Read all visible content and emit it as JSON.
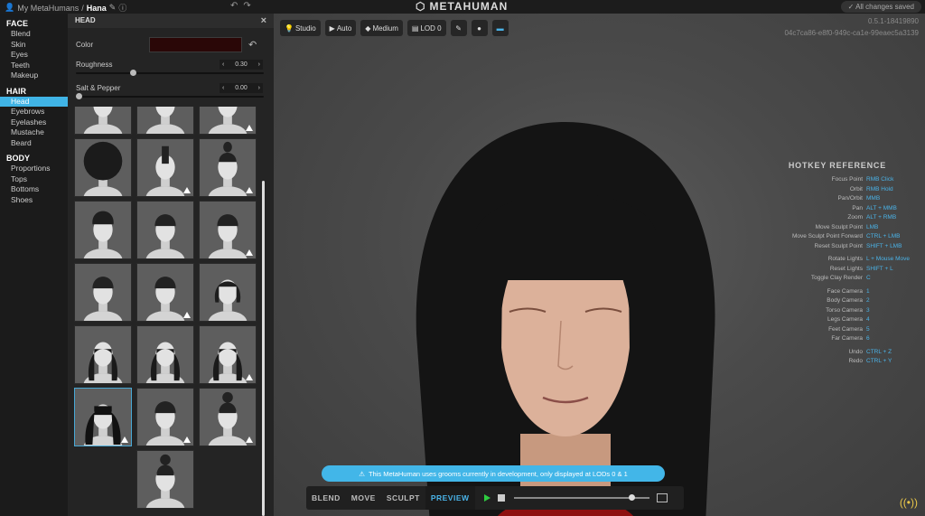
{
  "topbar": {
    "crumb_root": "My MetaHumans",
    "crumb_sep": "/",
    "crumb_current": "Hana",
    "brand": "METAHUMAN",
    "saved": "All changes saved"
  },
  "nav": {
    "sections": [
      {
        "title": "FACE",
        "items": [
          "Blend",
          "Skin",
          "Eyes",
          "Teeth",
          "Makeup"
        ]
      },
      {
        "title": "HAIR",
        "items": [
          "Head",
          "Eyebrows",
          "Eyelashes",
          "Mustache",
          "Beard"
        ]
      },
      {
        "title": "BODY",
        "items": [
          "Proportions",
          "Tops",
          "Bottoms",
          "Shoes"
        ]
      }
    ],
    "active": "Head"
  },
  "panel": {
    "title": "HEAD",
    "close": "×",
    "color_label": "Color",
    "color_value": "#2a0707",
    "roughness_label": "Roughness",
    "roughness_value": "0.30",
    "roughness_fraction": 0.3,
    "salt_label": "Salt & Pepper",
    "salt_value": "0.00",
    "salt_fraction": 0.0,
    "stepper_left": "‹",
    "stepper_right": "›"
  },
  "thumbs": [
    {
      "style": "bun",
      "warn": false
    },
    {
      "style": "bun",
      "warn": false
    },
    {
      "style": "bun",
      "warn": true
    },
    {
      "style": "afro",
      "warn": false
    },
    {
      "style": "mohawk",
      "warn": true
    },
    {
      "style": "topknot",
      "warn": true
    },
    {
      "style": "pomp",
      "warn": false
    },
    {
      "style": "short",
      "warn": false
    },
    {
      "style": "short",
      "warn": true
    },
    {
      "style": "short",
      "warn": false
    },
    {
      "style": "short",
      "warn": true
    },
    {
      "style": "bob",
      "warn": false
    },
    {
      "style": "long",
      "warn": false
    },
    {
      "style": "long",
      "warn": false
    },
    {
      "style": "long",
      "warn": true
    },
    {
      "style": "longbangs",
      "warn": true,
      "selected": true
    },
    {
      "style": "short",
      "warn": true
    },
    {
      "style": "topbun",
      "warn": true
    },
    {
      "style": "topbun",
      "warn": false
    }
  ],
  "viewport": {
    "toolbar": [
      "Studio",
      "Auto",
      "Medium",
      "LOD 0"
    ],
    "version": "0.5.1-18419890",
    "hash": "04c7ca86-e8f0-949c-ca1e-99eaec5a3139",
    "hotkey_title": "HOTKEY REFERENCE",
    "hotkeys": [
      {
        "a": "Focus Point",
        "k": "RMB Click"
      },
      {
        "a": "Orbit",
        "k": "RMB Hold"
      },
      {
        "a": "Pan/Orbit",
        "k": "MMB"
      },
      {
        "a": "Pan",
        "k": "ALT + MMB"
      },
      {
        "a": "Zoom",
        "k": "ALT + RMB"
      },
      {
        "a": "Move Sculpt Point",
        "k": "LMB"
      },
      {
        "a": "Move Sculpt Point Forward",
        "k": "CTRL + LMB"
      },
      {
        "a": "Reset Sculpt Point",
        "k": "SHIFT + LMB"
      },
      {
        "a": "Rotate Lights",
        "k": "L + Mouse Move",
        "gap": true
      },
      {
        "a": "Reset Lights",
        "k": "SHIFT + L"
      },
      {
        "a": "Toggle Clay Render",
        "k": "C"
      },
      {
        "a": "Face Camera",
        "k": "1",
        "gap": true
      },
      {
        "a": "Body Camera",
        "k": "2"
      },
      {
        "a": "Torso Camera",
        "k": "3"
      },
      {
        "a": "Legs Camera",
        "k": "4"
      },
      {
        "a": "Feet Camera",
        "k": "5"
      },
      {
        "a": "Far Camera",
        "k": "6"
      },
      {
        "a": "Undo",
        "k": "CTRL + Z",
        "gap": true
      },
      {
        "a": "Redo",
        "k": "CTRL + Y"
      }
    ],
    "notice": "This MetaHuman uses grooms currently in development, only displayed at LODs 0 & 1",
    "modes": [
      "BLEND",
      "MOVE",
      "SCULPT",
      "PREVIEW"
    ],
    "active_mode": "PREVIEW",
    "timeline_fraction": 0.88
  }
}
